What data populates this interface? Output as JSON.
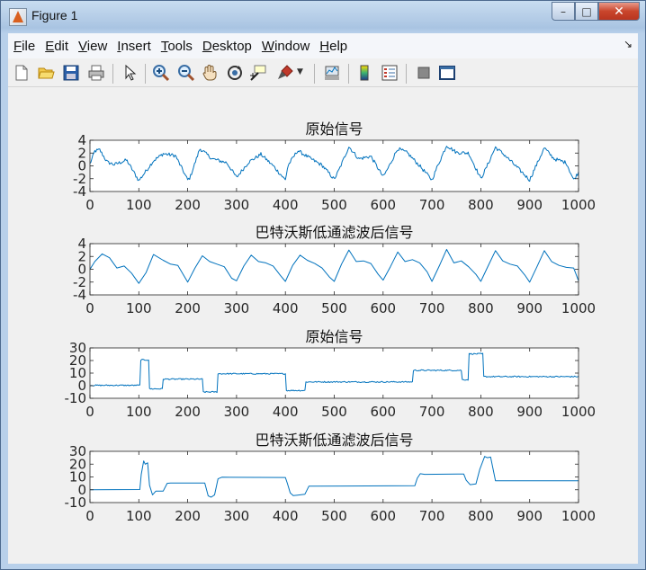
{
  "window": {
    "title": "Figure 1",
    "controls": {
      "minimize": "–",
      "maximize": "□",
      "close": "✕"
    }
  },
  "menu": [
    {
      "label": "File",
      "mnemonic": "F",
      "rest": "ile"
    },
    {
      "label": "Edit",
      "mnemonic": "E",
      "rest": "dit"
    },
    {
      "label": "View",
      "mnemonic": "V",
      "rest": "iew"
    },
    {
      "label": "Insert",
      "mnemonic": "I",
      "rest": "nsert"
    },
    {
      "label": "Tools",
      "mnemonic": "T",
      "rest": "ools"
    },
    {
      "label": "Desktop",
      "mnemonic": "D",
      "rest": "esktop"
    },
    {
      "label": "Window",
      "mnemonic": "W",
      "rest": "indow"
    },
    {
      "label": "Help",
      "mnemonic": "H",
      "rest": "elp"
    }
  ],
  "menu_overflow_icon": "dock-arrow-icon",
  "toolbar": [
    {
      "name": "new-figure",
      "icon": "new-file-icon"
    },
    {
      "name": "open-file",
      "icon": "folder-open-icon"
    },
    {
      "name": "save-figure",
      "icon": "floppy-disk-icon"
    },
    {
      "name": "print-figure",
      "icon": "printer-icon"
    },
    {
      "name": "edit-plot",
      "icon": "pointer-arrow-icon"
    },
    {
      "name": "zoom-in",
      "icon": "zoom-in-icon"
    },
    {
      "name": "zoom-out",
      "icon": "zoom-out-icon"
    },
    {
      "name": "pan",
      "icon": "hand-icon"
    },
    {
      "name": "rotate-3d",
      "icon": "rotate-icon"
    },
    {
      "name": "data-cursor",
      "icon": "data-cursor-icon"
    },
    {
      "name": "brush",
      "icon": "brush-icon"
    },
    {
      "name": "link-plot",
      "icon": "link-plot-icon"
    },
    {
      "name": "insert-colorbar",
      "icon": "colorbar-icon"
    },
    {
      "name": "insert-legend",
      "icon": "legend-icon"
    },
    {
      "name": "hide-plot-tools",
      "icon": "hide-tools-icon"
    },
    {
      "name": "show-plot-tools",
      "icon": "show-tools-icon"
    }
  ],
  "chart_data": [
    {
      "type": "line",
      "title": "原始信号",
      "xlim": [
        0,
        1000
      ],
      "ylim": [
        -4,
        4
      ],
      "xticks": [
        0,
        100,
        200,
        300,
        400,
        500,
        600,
        700,
        800,
        900,
        1000
      ],
      "yticks": [
        -4,
        -2,
        0,
        2,
        4
      ],
      "color": "#0072bd",
      "noisy": true,
      "x": [
        0,
        10,
        20,
        35,
        50,
        75,
        100,
        110,
        130,
        150,
        175,
        200,
        205,
        225,
        250,
        260,
        280,
        300,
        325,
        350,
        375,
        400,
        405,
        425,
        450,
        475,
        500,
        510,
        530,
        550,
        575,
        600,
        610,
        630,
        650,
        675,
        700,
        710,
        730,
        750,
        775,
        800,
        810,
        830,
        850,
        875,
        900,
        910,
        930,
        950,
        975,
        990,
        1000
      ],
      "y": [
        0.3,
        2.3,
        2.5,
        0.6,
        0.2,
        0.9,
        -2.3,
        -1.3,
        0.8,
        1.9,
        1.6,
        -2.2,
        -1.8,
        2.7,
        1.1,
        0.9,
        0.5,
        -1.8,
        0.6,
        1.8,
        0.0,
        -2.2,
        0.0,
        2.4,
        1.2,
        0.1,
        -2.1,
        -0.6,
        3.0,
        1.1,
        1.5,
        -1.7,
        -0.4,
        2.7,
        2.0,
        0.0,
        -2.2,
        -0.3,
        3.2,
        2.1,
        2.0,
        -2.0,
        -0.5,
        2.9,
        1.6,
        -0.3,
        -2.2,
        -0.5,
        2.8,
        1.1,
        0.5,
        -2.2,
        -1.0
      ]
    },
    {
      "type": "line",
      "title": "巴特沃斯低通滤波后信号",
      "xlim": [
        0,
        1000
      ],
      "ylim": [
        -4,
        4
      ],
      "xticks": [
        0,
        100,
        200,
        300,
        400,
        500,
        600,
        700,
        800,
        900,
        1000
      ],
      "yticks": [
        -4,
        -2,
        0,
        2,
        4
      ],
      "color": "#0072bd",
      "noisy": false,
      "x": [
        0,
        10,
        25,
        40,
        55,
        70,
        85,
        100,
        115,
        130,
        150,
        165,
        180,
        200,
        215,
        230,
        245,
        260,
        275,
        290,
        300,
        315,
        330,
        345,
        360,
        375,
        390,
        400,
        415,
        430,
        445,
        460,
        475,
        490,
        500,
        515,
        530,
        545,
        560,
        575,
        590,
        600,
        615,
        630,
        645,
        660,
        675,
        690,
        700,
        715,
        730,
        745,
        760,
        775,
        790,
        800,
        815,
        830,
        845,
        860,
        875,
        890,
        900,
        915,
        930,
        945,
        960,
        975,
        990,
        1000
      ],
      "y": [
        0.0,
        1.2,
        2.4,
        1.8,
        0.2,
        0.5,
        -0.6,
        -2.2,
        -0.5,
        2.3,
        1.4,
        0.8,
        0.6,
        -2.0,
        0.2,
        2.1,
        1.2,
        0.8,
        0.4,
        -1.4,
        -1.8,
        0.5,
        2.2,
        1.2,
        1.0,
        0.5,
        -1.0,
        -1.9,
        0.6,
        2.2,
        1.4,
        0.9,
        0.2,
        -1.2,
        -1.9,
        0.8,
        3.0,
        1.2,
        1.3,
        0.9,
        -0.8,
        -1.7,
        0.4,
        2.7,
        1.2,
        1.5,
        1.0,
        -0.4,
        -1.9,
        0.5,
        3.1,
        1.0,
        1.3,
        0.4,
        -0.8,
        -1.9,
        0.5,
        2.9,
        1.3,
        0.8,
        0.5,
        -0.9,
        -2.0,
        0.4,
        2.9,
        1.2,
        0.6,
        0.3,
        0.2,
        -1.8
      ]
    },
    {
      "type": "line",
      "title": "原始信号",
      "xlim": [
        0,
        1000
      ],
      "ylim": [
        -10,
        30
      ],
      "xticks": [
        0,
        100,
        200,
        300,
        400,
        500,
        600,
        700,
        800,
        900,
        1000
      ],
      "yticks": [
        -10,
        0,
        10,
        20,
        30
      ],
      "color": "#0072bd",
      "noisy": true,
      "x": [
        0,
        102,
        103,
        120,
        121,
        148,
        149,
        150,
        152,
        230,
        231,
        260,
        261,
        400,
        401,
        440,
        441,
        660,
        661,
        760,
        761,
        775,
        776,
        805,
        806,
        1000
      ],
      "y": [
        0.3,
        0.3,
        20.5,
        20.5,
        -2.5,
        -2.5,
        0.5,
        5.2,
        5.2,
        5.2,
        -5.0,
        -5.0,
        9.5,
        9.5,
        -3.8,
        -3.8,
        3.0,
        3.0,
        12.2,
        12.2,
        4.8,
        4.8,
        25.3,
        25.3,
        7.2,
        7.2
      ]
    },
    {
      "type": "line",
      "title": "巴特沃斯低通滤波后信号",
      "xlim": [
        0,
        1000
      ],
      "ylim": [
        -10,
        30
      ],
      "xticks": [
        0,
        100,
        200,
        300,
        400,
        500,
        600,
        700,
        800,
        900,
        1000
      ],
      "yticks": [
        -10,
        0,
        10,
        20,
        30
      ],
      "color": "#0072bd",
      "noisy": false,
      "x": [
        0,
        102,
        105,
        110,
        113,
        118,
        122,
        128,
        135,
        150,
        158,
        165,
        235,
        238,
        242,
        248,
        255,
        262,
        270,
        400,
        404,
        410,
        416,
        425,
        440,
        448,
        665,
        670,
        676,
        685,
        765,
        770,
        778,
        790,
        798,
        808,
        813,
        820,
        830,
        1000
      ],
      "y": [
        0.0,
        0.2,
        12.0,
        22.5,
        20.0,
        21.0,
        3.5,
        -4.0,
        -1.0,
        -1.0,
        5.0,
        5.2,
        5.2,
        1.0,
        -4.8,
        -5.8,
        -4.0,
        8.5,
        9.8,
        9.6,
        5.0,
        -2.5,
        -4.5,
        -4.2,
        -3.5,
        2.8,
        3.2,
        9.0,
        12.5,
        12.0,
        12.3,
        7.5,
        4.0,
        4.5,
        16.0,
        26.0,
        25.0,
        25.5,
        7.0,
        7.0
      ]
    }
  ]
}
